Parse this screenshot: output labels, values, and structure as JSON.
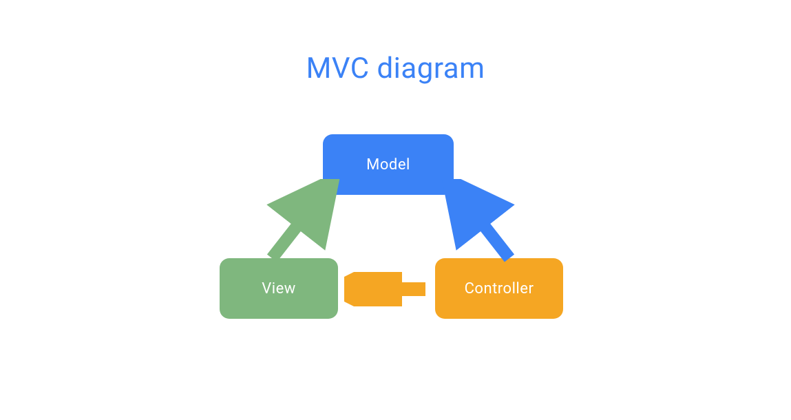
{
  "title": "MVC diagram",
  "nodes": {
    "model": {
      "label": "Model",
      "color": "#3b82f6"
    },
    "view": {
      "label": "View",
      "color": "#7fb77e"
    },
    "controller": {
      "label": "Controller",
      "color": "#f5a623"
    }
  },
  "arrows": [
    {
      "from": "view",
      "to": "model",
      "color": "#7fb77e"
    },
    {
      "from": "controller",
      "to": "model",
      "color": "#3b82f6"
    },
    {
      "from": "controller",
      "to": "view",
      "color": "#f5a623"
    }
  ]
}
